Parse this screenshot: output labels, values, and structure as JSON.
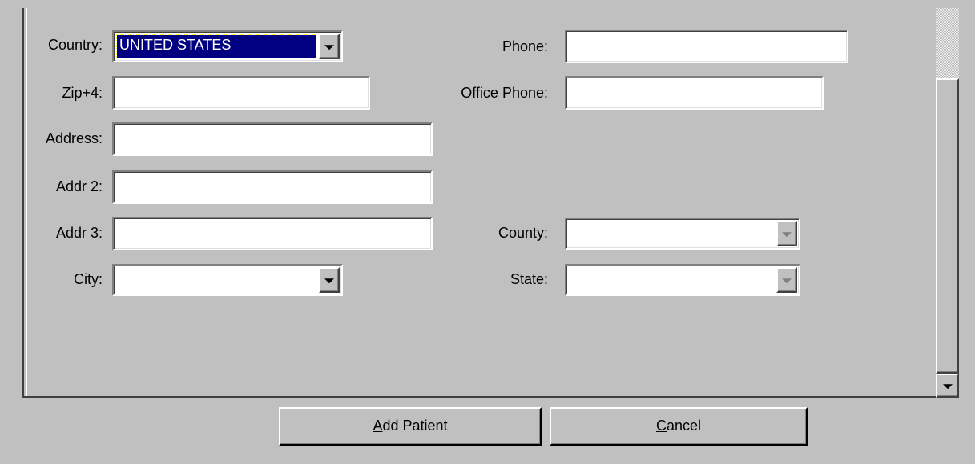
{
  "form": {
    "country": {
      "label": "Country:",
      "value": "UNITED STATES"
    },
    "zip": {
      "label": "Zip+4:",
      "value": ""
    },
    "address": {
      "label": "Address:",
      "value": ""
    },
    "addr2": {
      "label": "Addr 2:",
      "value": ""
    },
    "addr3": {
      "label": "Addr 3:",
      "value": ""
    },
    "city": {
      "label": "City:",
      "value": ""
    },
    "phone": {
      "label": "Phone:",
      "value": ""
    },
    "office_phone": {
      "label": "Office Phone:",
      "value": ""
    },
    "county": {
      "label": "County:",
      "value": ""
    },
    "state": {
      "label": "State:",
      "value": ""
    }
  },
  "buttons": {
    "add_patient": {
      "mnemonic": "A",
      "rest": "dd Patient"
    },
    "cancel": {
      "mnemonic": "C",
      "rest": "ancel"
    }
  },
  "icons": {
    "dropdown": "chevron-down-icon",
    "scroll_down": "scroll-down-arrow-icon"
  },
  "colors": {
    "background": "#c0c0c0",
    "selection": "#000080",
    "field": "#ffffff"
  }
}
